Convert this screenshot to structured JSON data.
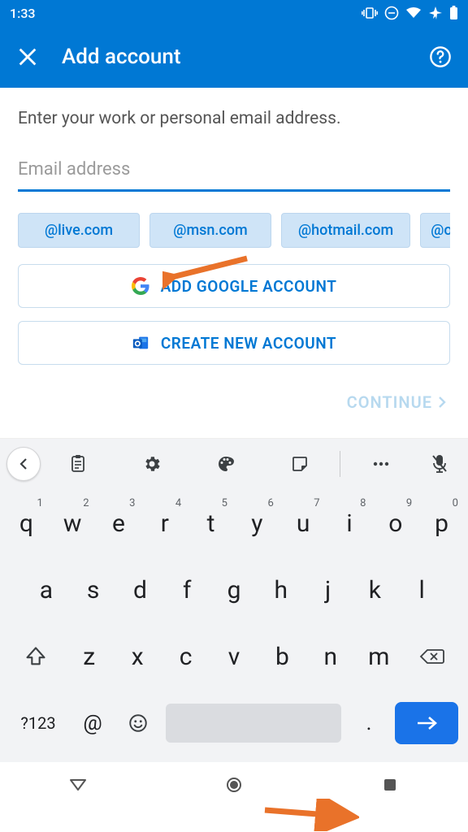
{
  "status": {
    "time": "1:33"
  },
  "header": {
    "title": "Add account"
  },
  "content": {
    "prompt": "Enter your work or personal email address.",
    "email_placeholder": "Email address",
    "chips": [
      "@live.com",
      "@msn.com",
      "@hotmail.com",
      "@o"
    ],
    "google_btn": "ADD GOOGLE ACCOUNT",
    "create_btn": "CREATE NEW ACCOUNT",
    "continue": "CONTINUE"
  },
  "keyboard": {
    "row1": [
      "q",
      "w",
      "e",
      "r",
      "t",
      "y",
      "u",
      "i",
      "o",
      "p"
    ],
    "row1_sup": [
      "1",
      "2",
      "3",
      "4",
      "5",
      "6",
      "7",
      "8",
      "9",
      "0"
    ],
    "row2": [
      "a",
      "s",
      "d",
      "f",
      "g",
      "h",
      "j",
      "k",
      "l"
    ],
    "row3": [
      "z",
      "x",
      "c",
      "v",
      "b",
      "n",
      "m"
    ],
    "sym": "?123",
    "at": "@",
    "dot": "."
  }
}
